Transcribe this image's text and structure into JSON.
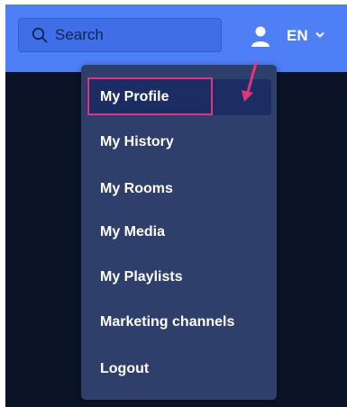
{
  "search": {
    "placeholder": "Search"
  },
  "header": {
    "language": "EN"
  },
  "menu": {
    "items": [
      {
        "label": "My Profile"
      },
      {
        "label": "My History"
      },
      {
        "label": "My Rooms"
      },
      {
        "label": "My Media"
      },
      {
        "label": "My Playlists"
      },
      {
        "label": "Marketing channels"
      },
      {
        "label": "Logout"
      }
    ]
  },
  "colors": {
    "topbar": "#4f7ff7",
    "menu_bg": "#2f3f6b",
    "active_item_bg": "#1b2d63",
    "annotation": "#e2347c",
    "page_dark": "#0b1426"
  },
  "icons": [
    "search-icon",
    "user-icon",
    "chevron-down-icon"
  ]
}
